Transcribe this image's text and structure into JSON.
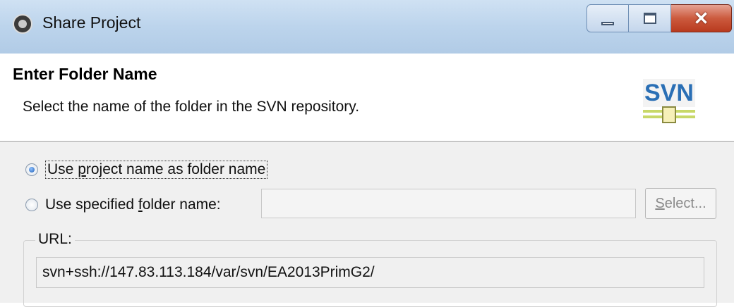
{
  "window": {
    "title": "Share Project",
    "icon": "eclipse-gear-icon"
  },
  "header": {
    "title": "Enter Folder Name",
    "description": "Select the name of the folder in the SVN repository.",
    "logo_text": "SVN"
  },
  "options": {
    "use_project_name": {
      "label_pre": "Use ",
      "label_mnemonic": "p",
      "label_post": "roject name as folder name",
      "selected": true
    },
    "use_specified": {
      "label_pre": "Use specified ",
      "label_mnemonic": "f",
      "label_post": "older name:",
      "selected": false,
      "input_value": ""
    }
  },
  "select_button": {
    "mnemonic": "S",
    "label_rest": "elect..."
  },
  "url": {
    "label": "URL:",
    "value": "svn+ssh://147.83.113.184/var/svn/EA2013PrimG2/"
  },
  "colors": {
    "titlebar": "#bcd4ec",
    "close_button": "#c9472a",
    "body_bg": "#f0f0f0",
    "svn_blue": "#2a6fb5",
    "svn_green": "#c8d868"
  }
}
